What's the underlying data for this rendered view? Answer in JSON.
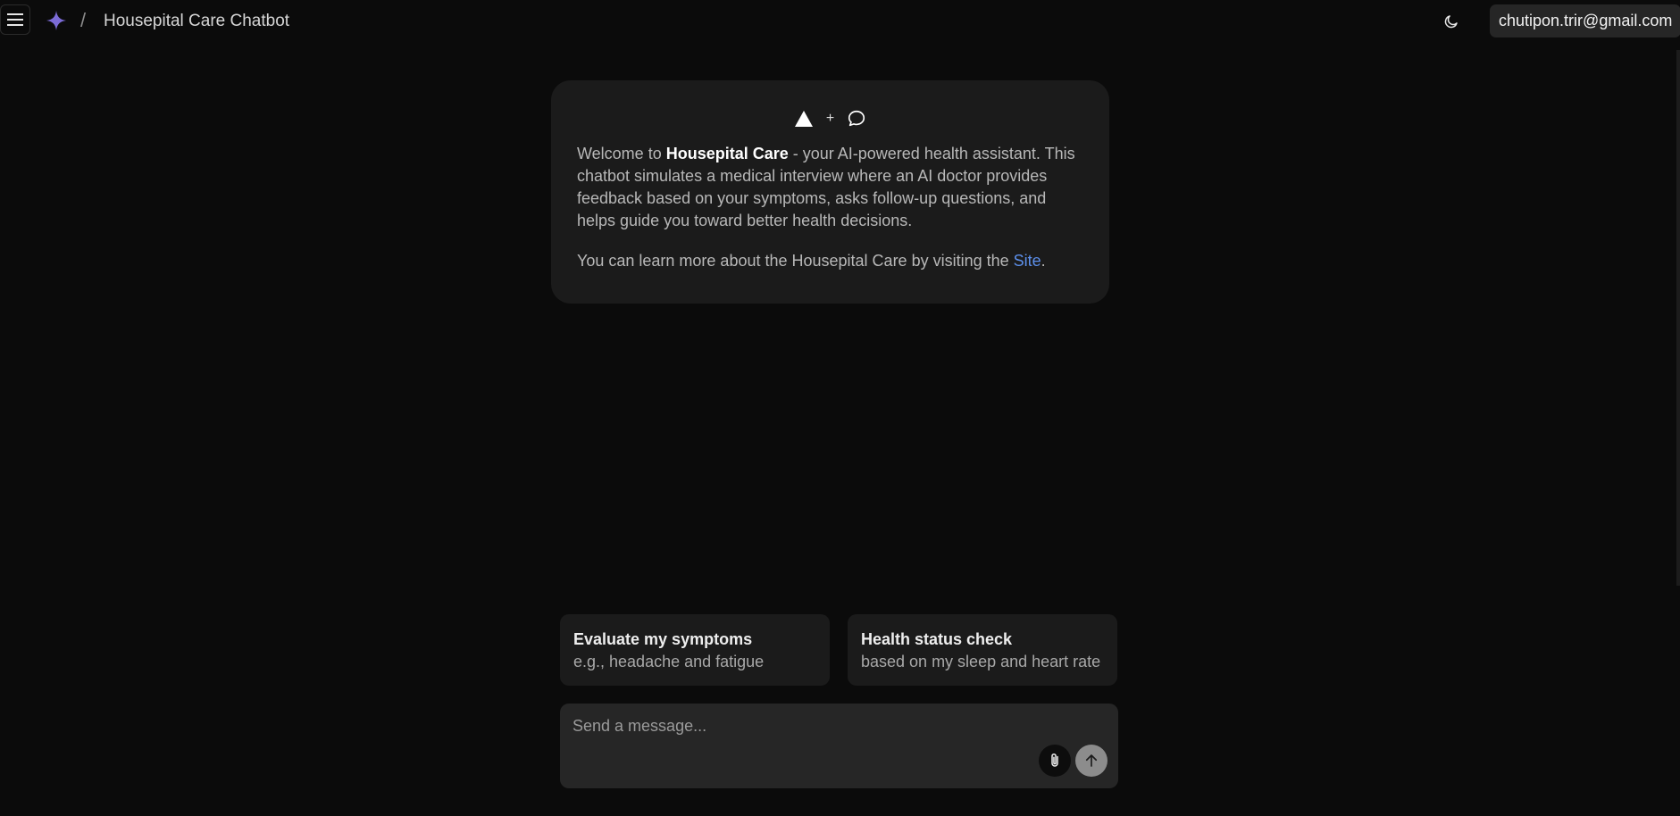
{
  "header": {
    "title": "Housepital Care Chatbot",
    "separator": "/",
    "user_email": "chutipon.trir@gmail.com"
  },
  "icons": {
    "menu": "hamburger-menu-icon",
    "logo": "sparkle-icon",
    "theme": "moon-icon",
    "triangle": "triangle-logo-icon",
    "chat": "chat-bubble-icon",
    "attach": "paperclip-icon",
    "send": "arrow-up-icon"
  },
  "colors": {
    "background": "#0b0b0b",
    "card": "#1b1b1b",
    "accent_sparkle": "#7b6bd6",
    "link": "#5c8fea"
  },
  "welcome": {
    "plus": "+",
    "intro_prefix": "Welcome to ",
    "brand": "Housepital Care",
    "intro_suffix": " - your AI-powered health assistant. This chatbot simulates a medical interview where an AI doctor provides feedback based on your symptoms, asks follow-up questions, and helps guide you toward better health decisions.",
    "learn_prefix": "You can learn more about the Housepital Care by visiting the ",
    "link_text": "Site",
    "learn_suffix": "."
  },
  "suggestions": [
    {
      "title": "Evaluate my symptoms",
      "subtitle": "e.g., headache and fatigue"
    },
    {
      "title": "Health status check",
      "subtitle": "based on my sleep and heart rate"
    }
  ],
  "composer": {
    "placeholder": "Send a message..."
  }
}
